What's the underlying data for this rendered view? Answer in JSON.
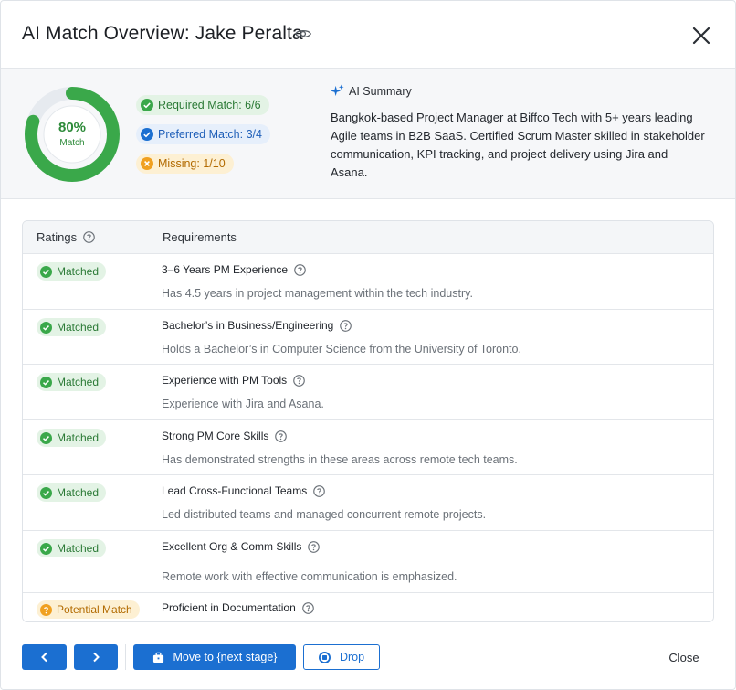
{
  "header": {
    "title": "AI Match Overview: Jake Peralta",
    "eye_icon": "eye-icon",
    "close_icon": "close-icon"
  },
  "summary": {
    "match_percent": 80,
    "match_percent_label": "80%",
    "match_label": "Match",
    "chips": {
      "required": "Required Match: 6/6",
      "preferred": "Preferred Match: 3/4",
      "missing": "Missing: 1/10"
    },
    "ai_summary_title": "AI Summary",
    "ai_summary_text": "Bangkok-based Project Manager at Biffco Tech with 5+ years leading Agile teams in B2B SaaS. Certified Scrum Master skilled in stakeholder communication, KPI tracking, and project delivery using Jira and Asana."
  },
  "table": {
    "headers": {
      "ratings": "Ratings",
      "requirements": "Requirements"
    },
    "rows": [
      {
        "status": "Matched",
        "title": "3–6 Years PM Experience",
        "description": "Has 4.5 years in project management within the tech industry."
      },
      {
        "status": "Matched",
        "title": "Bachelor’s in Business/Engineering",
        "description": "Holds a Bachelor’s in Computer Science from the University of Toronto."
      },
      {
        "status": "Matched",
        "title": "Experience with PM Tools",
        "description": "Experience with Jira and Asana."
      },
      {
        "status": "Matched",
        "title": "Strong PM Core Skills",
        "description": "Has demonstrated strengths in these areas across remote tech teams."
      },
      {
        "status": "Matched",
        "title": "Lead Cross-Functional Teams",
        "description": "Led distributed teams and managed concurrent remote projects."
      },
      {
        "status": "Matched",
        "title": "Excellent Org & Comm Skills",
        "description": "Remote work with effective communication is emphasized."
      },
      {
        "status": "Potential Match",
        "title": "Proficient in Documentation",
        "description": ""
      }
    ]
  },
  "footer": {
    "prev_label": "‹",
    "next_label": "›",
    "move_label": "Move to {next stage}",
    "drop_label": "Drop",
    "close_label": "Close"
  },
  "colors": {
    "primary": "#1b6fd1",
    "success": "#2e8b3a",
    "warning": "#f0a020"
  }
}
